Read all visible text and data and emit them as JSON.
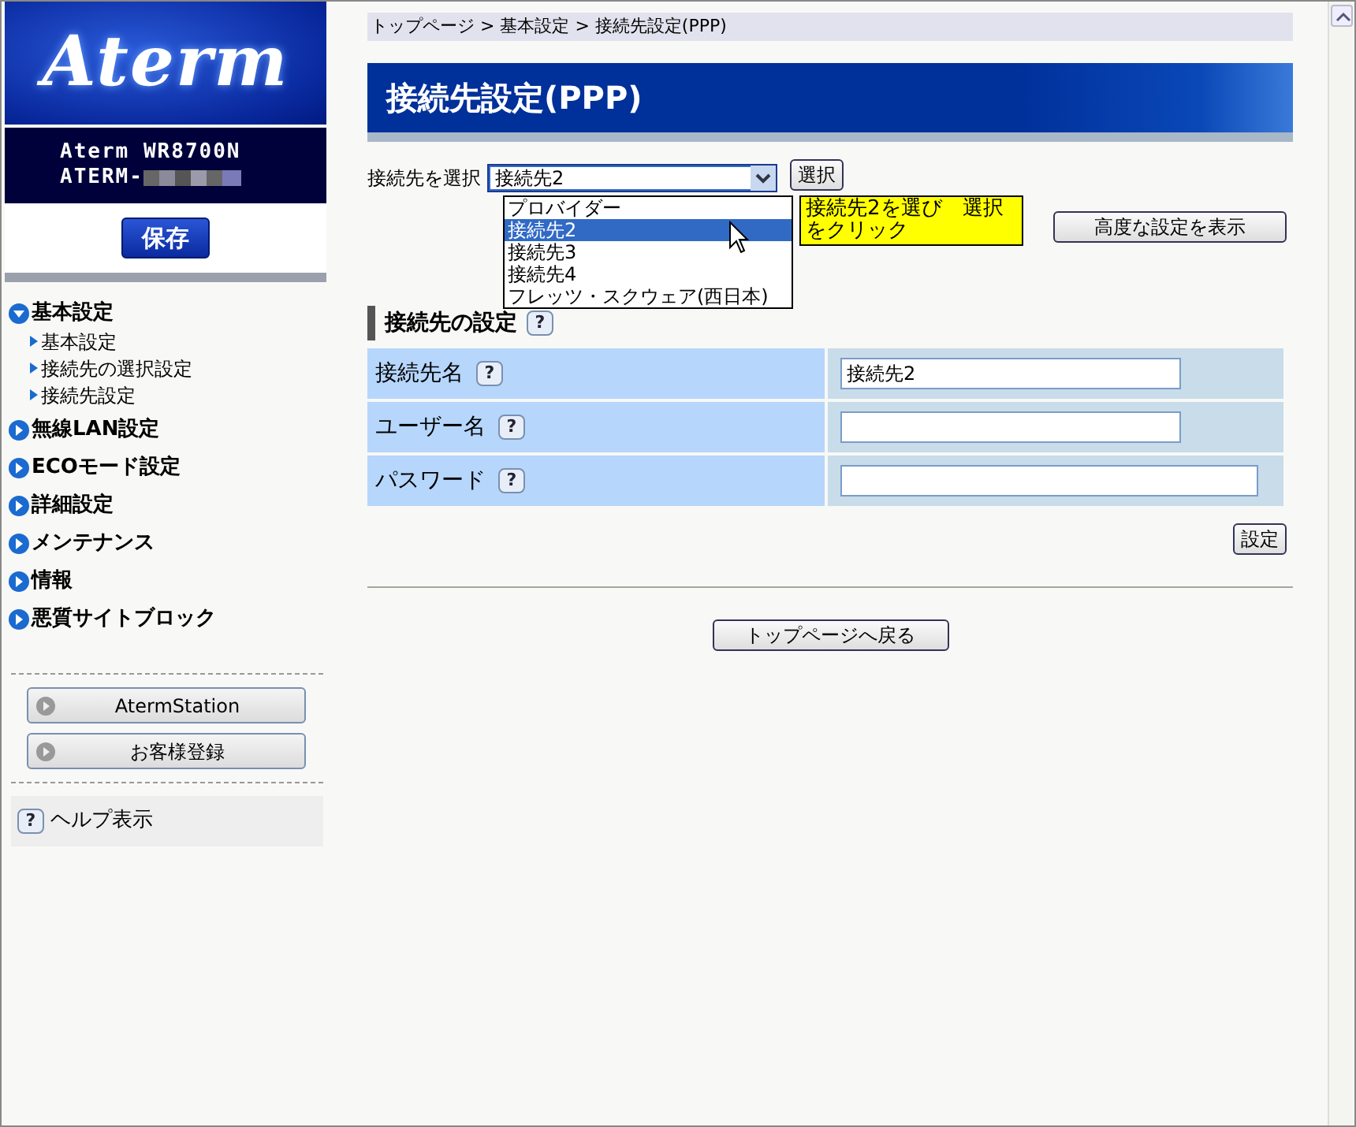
{
  "logo": "Aterm",
  "device": {
    "model": "Aterm WR8700N",
    "name": "ATERM-"
  },
  "save_button": "保存",
  "nav": [
    {
      "label": "基本設定",
      "expanded": true,
      "children": [
        {
          "label": "基本設定"
        },
        {
          "label": "接続先の選択設定"
        },
        {
          "label": "接続先設定"
        }
      ]
    },
    {
      "label": "無線LAN設定",
      "expanded": false
    },
    {
      "label": "ECOモード設定",
      "expanded": false
    },
    {
      "label": "詳細設定",
      "expanded": false
    },
    {
      "label": "メンテナンス",
      "expanded": false
    },
    {
      "label": "情報",
      "expanded": false
    },
    {
      "label": "悪質サイトブロック",
      "expanded": false
    }
  ],
  "link_buttons": [
    "AtermStation",
    "お客様登録"
  ],
  "help": {
    "icon": "?",
    "label": "ヘルプ表示"
  },
  "breadcrumb": "トップページ > 基本設定 > 接続先設定(PPP)",
  "page_title": "接続先設定(PPP)",
  "select": {
    "label": "接続先を選択",
    "value": "接続先2",
    "expanded": true,
    "options": [
      {
        "label": "プロバイダー",
        "selected": false
      },
      {
        "label": "接続先2",
        "selected": true
      },
      {
        "label": "接続先3",
        "selected": false
      },
      {
        "label": "接続先4",
        "selected": false
      },
      {
        "label": "フレッツ・スクウェア(西日本)",
        "selected": false
      }
    ]
  },
  "select_button": "選択",
  "tooltip": "接続先2を選び　選択をクリック",
  "advanced_button": "高度な設定を表示",
  "section": {
    "title": "接続先の設定",
    "help": "?"
  },
  "fields": [
    {
      "kind": "text",
      "label": "接続先名",
      "help": "?",
      "value": "接続先2"
    },
    {
      "kind": "text",
      "label": "ユーザー名",
      "help": "?"
    },
    {
      "kind": "password",
      "label": "パスワード",
      "help": "?"
    }
  ],
  "set_button": "設定",
  "back_button": "トップページへ戻る"
}
